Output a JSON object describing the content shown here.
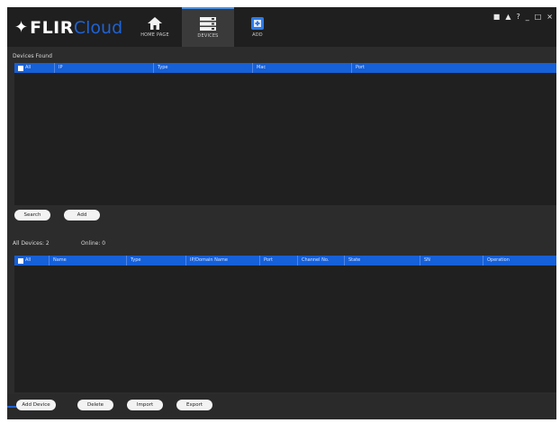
{
  "app": {
    "logo_main": "FLIR",
    "logo_accent": "Cloud"
  },
  "nav": {
    "tabs": [
      {
        "label": "HOME PAGE",
        "icon": "home-icon"
      },
      {
        "label": "DEVICES",
        "icon": "server-icon",
        "active": true
      },
      {
        "label": "ADD",
        "icon": "add-icon"
      }
    ]
  },
  "window_controls": [
    "user-icon",
    "lock-icon",
    "help-icon",
    "minimize-icon",
    "maximize-icon",
    "close-icon"
  ],
  "found": {
    "title": "Devices Found",
    "columns": [
      "All",
      "IP",
      "Type",
      "Mac",
      "Port"
    ],
    "buttons": {
      "search": "Search",
      "add": "Add"
    }
  },
  "all_devices": {
    "count_label": "All Devices: 2",
    "online_label": "Online: 0",
    "columns": [
      "All",
      "Name",
      "Type",
      "IP/Domain Name",
      "Port",
      "Channel No.",
      "State",
      "SN",
      "Operation"
    ],
    "buttons": {
      "add_device": "Add Device",
      "delete": "Delete",
      "import": "Import",
      "export": "Export"
    }
  },
  "colors": {
    "accent": "#1660d8",
    "background": "#2c2c2c",
    "titlebar": "#1f1f1f"
  }
}
